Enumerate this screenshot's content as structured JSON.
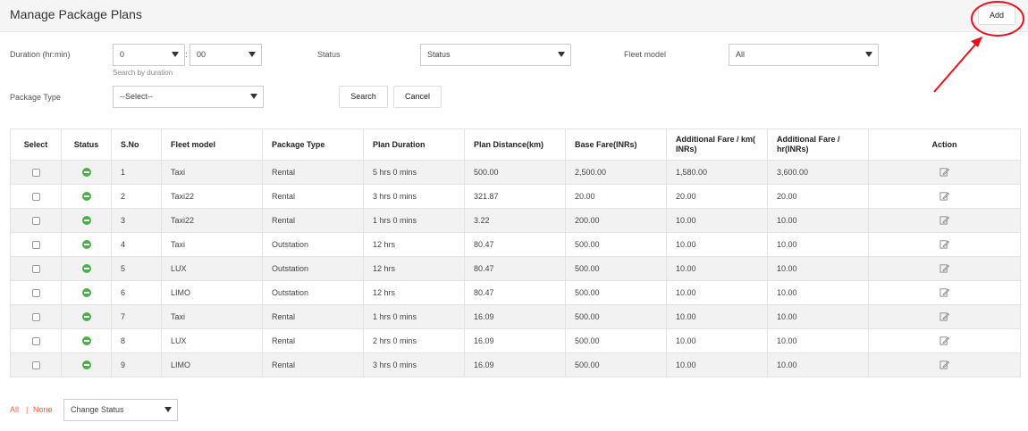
{
  "header": {
    "title": "Manage Package Plans",
    "add_label": "Add"
  },
  "filters": {
    "duration_label": "Duration (hr:min)",
    "duration_hours": "0",
    "duration_colon": ":",
    "duration_minutes": "00",
    "duration_hint": "Search by duration",
    "status_label": "Status",
    "status_value": "Status",
    "fleet_label": "Fleet model",
    "fleet_value": "All",
    "package_type_label": "Package Type",
    "package_type_value": "--Select--",
    "search_label": "Search",
    "cancel_label": "Cancel"
  },
  "table": {
    "headers": [
      "Select",
      "Status",
      "S.No",
      "Fleet model",
      "Package Type",
      "Plan Duration",
      "Plan Distance(km)",
      "Base Fare(INRs)",
      "Additional Fare / km( INRs)",
      "Additional Fare / hr(INRs)",
      "Action"
    ],
    "rows": [
      {
        "sno": "1",
        "fleet": "Taxi",
        "type": "Rental",
        "duration": "5 hrs 0 mins",
        "distance": "500.00",
        "base": "2,500.00",
        "add_km": "1,580.00",
        "add_hr": "3,600.00"
      },
      {
        "sno": "2",
        "fleet": "Taxi22",
        "type": "Rental",
        "duration": "3 hrs 0 mins",
        "distance": "321.87",
        "base": "20.00",
        "add_km": "20.00",
        "add_hr": "20.00"
      },
      {
        "sno": "3",
        "fleet": "Taxi22",
        "type": "Rental",
        "duration": "1 hrs 0 mins",
        "distance": "3.22",
        "base": "200.00",
        "add_km": "10.00",
        "add_hr": "10.00"
      },
      {
        "sno": "4",
        "fleet": "Taxi",
        "type": "Outstation",
        "duration": "12 hrs",
        "distance": "80.47",
        "base": "500.00",
        "add_km": "10.00",
        "add_hr": "10.00"
      },
      {
        "sno": "5",
        "fleet": "LUX",
        "type": "Outstation",
        "duration": "12 hrs",
        "distance": "80.47",
        "base": "500.00",
        "add_km": "10.00",
        "add_hr": "10.00"
      },
      {
        "sno": "6",
        "fleet": "LIMO",
        "type": "Outstation",
        "duration": "12 hrs",
        "distance": "80.47",
        "base": "500.00",
        "add_km": "10.00",
        "add_hr": "10.00"
      },
      {
        "sno": "7",
        "fleet": "Taxi",
        "type": "Rental",
        "duration": "1 hrs 0 mins",
        "distance": "16.09",
        "base": "500.00",
        "add_km": "10.00",
        "add_hr": "10.00"
      },
      {
        "sno": "8",
        "fleet": "LUX",
        "type": "Rental",
        "duration": "2 hrs 0 mins",
        "distance": "16.09",
        "base": "500.00",
        "add_km": "10.00",
        "add_hr": "10.00"
      },
      {
        "sno": "9",
        "fleet": "LIMO",
        "type": "Rental",
        "duration": "3 hrs 0 mins",
        "distance": "16.09",
        "base": "500.00",
        "add_km": "10.00",
        "add_hr": "10.00"
      }
    ]
  },
  "footer": {
    "all_label": "All",
    "separator": "|",
    "none_label": "None",
    "change_status_label": "Change Status"
  },
  "icons": {
    "status": "status-active-icon",
    "action": "edit-icon"
  },
  "colors": {
    "status_active": "#4cae4c",
    "footer_link": "#e8674a",
    "annotation": "#e8111b"
  }
}
